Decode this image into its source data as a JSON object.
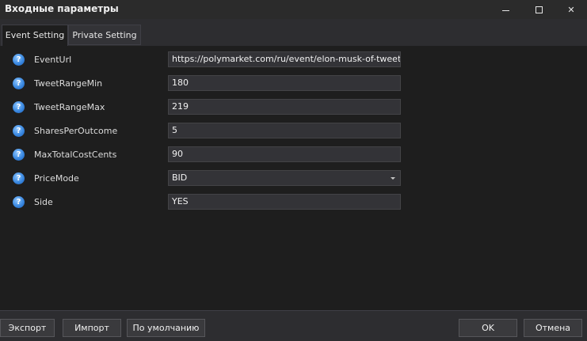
{
  "window": {
    "title": "Входные параметры",
    "close_glyph": "✕"
  },
  "tabs": [
    {
      "label": "Event Setting",
      "active": true
    },
    {
      "label": "Private Setting",
      "active": false
    }
  ],
  "help_icon": {
    "glyph": "?",
    "icon": "question-circle-icon",
    "color": "#3a88e0"
  },
  "params": [
    {
      "label": "EventUrl",
      "value": "https://polymarket.com/ru/event/elon-musk-of-tweets-sep"
    },
    {
      "label": "TweetRangeMin",
      "value": "180"
    },
    {
      "label": "TweetRangeMax",
      "value": "219"
    },
    {
      "label": "SharesPerOutcome",
      "value": "5"
    },
    {
      "label": "MaxTotalCostCents",
      "value": "90"
    },
    {
      "label": "PriceMode",
      "value": "BID",
      "type": "dropdown"
    },
    {
      "label": "Side",
      "value": "YES"
    }
  ],
  "footer": {
    "export_label": "Экспорт",
    "import_label": "Импорт",
    "default_label": "По умолчанию",
    "ok_label": "OK",
    "cancel_label": "Отмена"
  }
}
